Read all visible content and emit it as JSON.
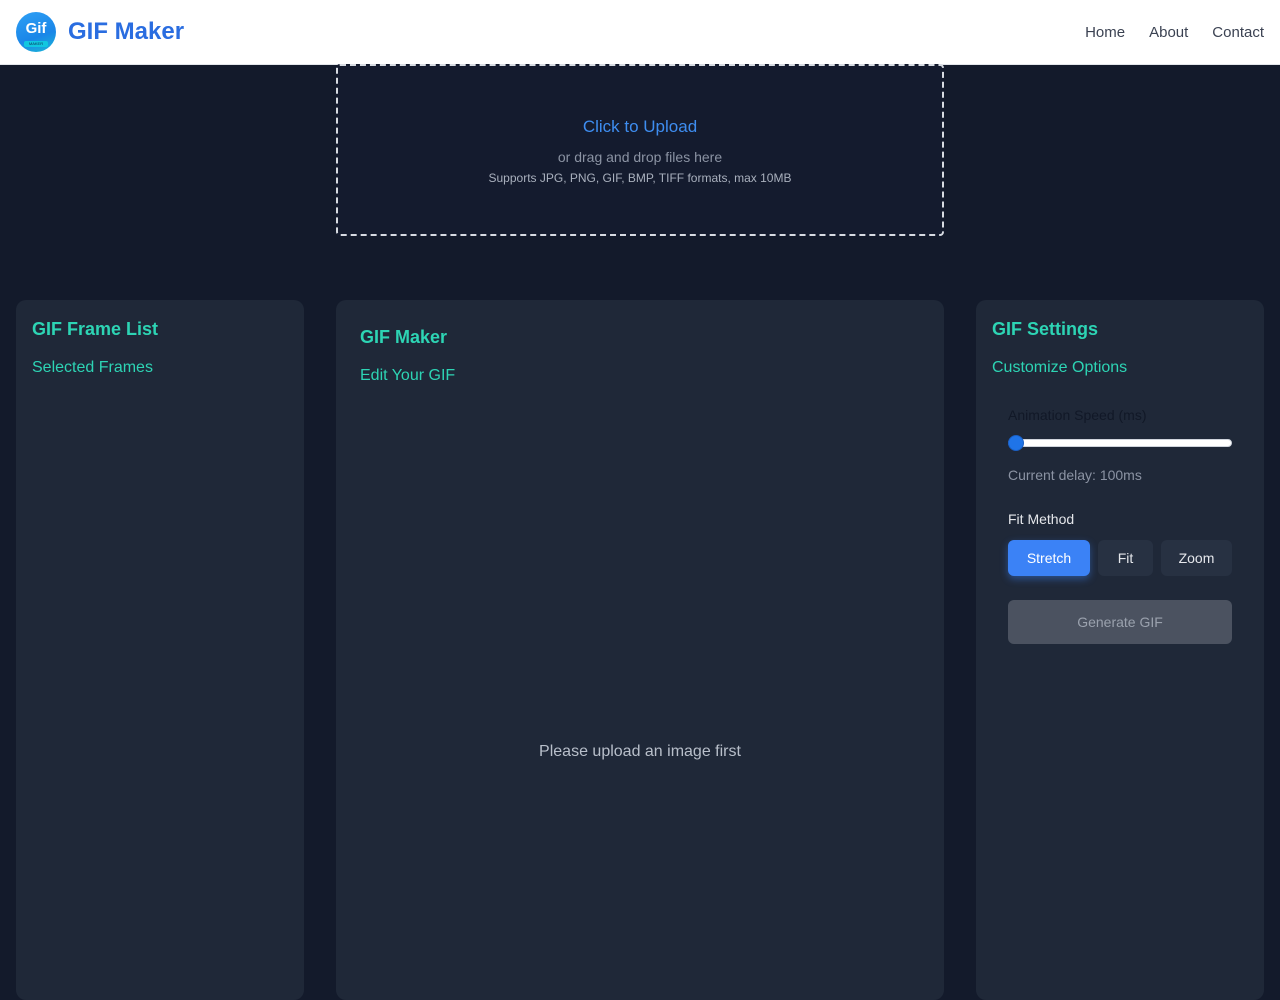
{
  "header": {
    "logo_text": "Gif",
    "logo_sub": "MAKER",
    "brand": "GIF Maker",
    "nav": [
      {
        "label": "Home"
      },
      {
        "label": "About"
      },
      {
        "label": "Contact"
      }
    ]
  },
  "upload": {
    "title": "Click to Upload",
    "subtitle": "or drag and drop files here",
    "hint": "Supports JPG, PNG, GIF, BMP, TIFF formats, max 10MB"
  },
  "frame_list": {
    "title": "GIF Frame List",
    "subtitle": "Selected Frames"
  },
  "editor": {
    "title": "GIF Maker",
    "subtitle": "Edit Your GIF",
    "placeholder": "Please upload an image first"
  },
  "settings": {
    "title": "GIF Settings",
    "subtitle": "Customize Options",
    "speed_label": "Animation Speed (ms)",
    "speed_fraction": 0.0,
    "delay_text": "Current delay: 100ms",
    "fit_label": "Fit Method",
    "fit_options": [
      {
        "label": "Stretch",
        "active": true
      },
      {
        "label": "Fit",
        "active": false
      },
      {
        "label": "Zoom",
        "active": false
      }
    ],
    "generate_label": "Generate GIF"
  },
  "colors": {
    "accent": "#3b82f6",
    "teal": "#2dd4b4",
    "brand": "#2a6de0",
    "background": "#131a2b",
    "panel": "#1f2838"
  }
}
